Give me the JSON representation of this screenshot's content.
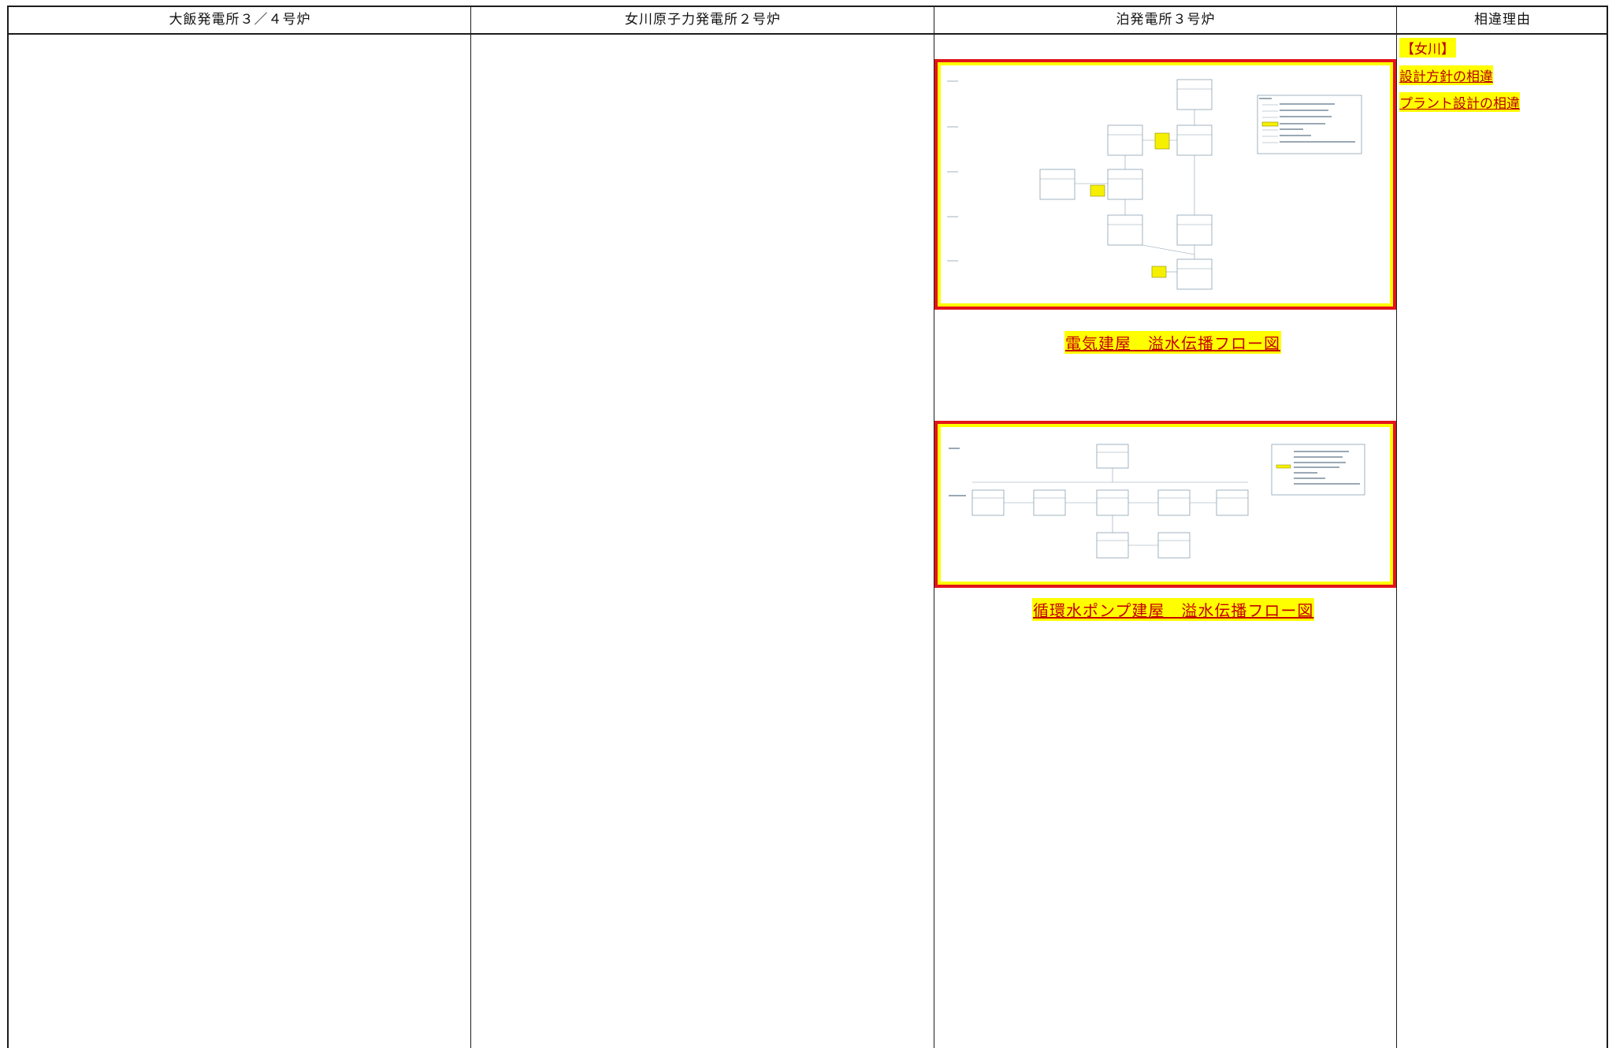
{
  "table": {
    "headers": [
      "大飯発電所３／４号炉",
      "女川原子力発電所２号炉",
      "泊発電所３号炉",
      "相違理由"
    ]
  },
  "figures": [
    {
      "caption": "電気建屋　溢水伝播フロー図"
    },
    {
      "caption": "循環水ポンプ建屋　溢水伝播フロー図"
    }
  ],
  "reasons": {
    "tag": "【女川】",
    "items": [
      "設計方針の相違",
      "プラント設計の相違"
    ]
  },
  "colors": {
    "highlight": "#ffff00",
    "frame_red": "#e3141b",
    "caption_text": "#c40000",
    "rule": "#1c1c1c"
  }
}
